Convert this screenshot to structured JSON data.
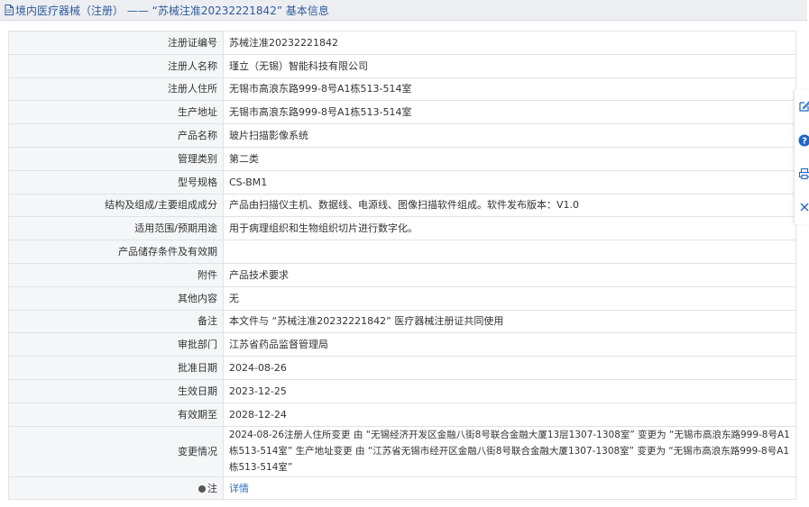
{
  "header": {
    "title": "境内医疗器械（注册） —— “苏械注准20232221842” 基本信息"
  },
  "rows": [
    {
      "label": "注册证编号",
      "value": "苏械注准20232221842"
    },
    {
      "label": "注册人名称",
      "value": "瑾立（无锡）智能科技有限公司"
    },
    {
      "label": "注册人住所",
      "value": "无锡市高浪东路999-8号A1栋513-514室"
    },
    {
      "label": "生产地址",
      "value": "无锡市高浪东路999-8号A1栋513-514室"
    },
    {
      "label": "产品名称",
      "value": "玻片扫描影像系统"
    },
    {
      "label": "管理类别",
      "value": "第二类"
    },
    {
      "label": "型号规格",
      "value": "CS-BM1"
    },
    {
      "label": "结构及组成/主要组成成分",
      "value": "产品由扫描仪主机、数据线、电源线、图像扫描软件组成。软件发布版本：V1.0"
    },
    {
      "label": "适用范围/预期用途",
      "value": "用于病理组织和生物组织切片进行数字化。"
    },
    {
      "label": "产品储存条件及有效期",
      "value": ""
    },
    {
      "label": "附件",
      "value": "产品技术要求"
    },
    {
      "label": "其他内容",
      "value": "无"
    },
    {
      "label": "备注",
      "value": "本文件与 “苏械注准20232221842” 医疗器械注册证共同使用"
    },
    {
      "label": "审批部门",
      "value": "江苏省药品监督管理局"
    },
    {
      "label": "批准日期",
      "value": "2024-08-26"
    },
    {
      "label": "生效日期",
      "value": "2023-12-25"
    },
    {
      "label": "有效期至",
      "value": "2028-12-24"
    },
    {
      "label": "变更情况",
      "value": "2024-08-26注册人住所变更 由 “无锡经济开发区金融八街8号联合金融大厦13层1307-1308室” 变更为 “无锡市高浪东路999-8号A1栋513-514室” 生产地址变更 由 “江苏省无锡市经开区金融八街8号联合金融大厦1307-1308室” 变更为 “无锡市高浪东路999-8号A1栋513-514室”"
    },
    {
      "label": "注",
      "value": "详情"
    }
  ],
  "toolbar": {
    "icons": [
      "edit-icon",
      "help-icon",
      "print-icon",
      "close-icon"
    ]
  },
  "colors": {
    "title_text": "#2f5b9a",
    "label_bg": "#f5f6f8",
    "border": "#dfe2e6",
    "link": "#2d6fc7",
    "help_blue": "#1f66c9"
  }
}
